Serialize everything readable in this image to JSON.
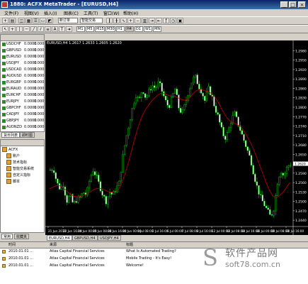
{
  "window": {
    "title": "1880: ACFX MetaTrader - [EURUSD,H4]",
    "controls": [
      "_",
      "□",
      "×"
    ]
  },
  "menu": [
    "文件(F)",
    "视图(V)",
    "插入(I)",
    "图表(C)",
    "工具(T)",
    "窗口(W)",
    "帮助(H)"
  ],
  "toolbar": {
    "new_order_label": "新订单",
    "expert_label": "智能交易",
    "period_labels": [
      "M1",
      "M5",
      "M15",
      "M30",
      "H1",
      "H4",
      "D1",
      "W1",
      "MN"
    ]
  },
  "market_watch": {
    "rows": [
      {
        "symbol": "USDCHF",
        "bid": "0.0000",
        "ask": "0.0000"
      },
      {
        "symbol": "GBPUSD",
        "bid": "0.0000",
        "ask": "0.0000"
      },
      {
        "symbol": "EURUSD",
        "bid": "0.0000",
        "ask": "0.0000"
      },
      {
        "symbol": "USDJPY",
        "bid": "0.0000",
        "ask": "0.0000"
      },
      {
        "symbol": "USDCAD",
        "bid": "0.0000",
        "ask": "0.0000"
      },
      {
        "symbol": "AUDUSD",
        "bid": "0.0000",
        "ask": "0.0000"
      },
      {
        "symbol": "EURGBP",
        "bid": "0.0000",
        "ask": "0.0000"
      },
      {
        "symbol": "EURAUD",
        "bid": "0.0000",
        "ask": "0.0000"
      },
      {
        "symbol": "EURCHF",
        "bid": "0.0000",
        "ask": "0.0000"
      },
      {
        "symbol": "EURJPY",
        "bid": "0.0000",
        "ask": "0.0000"
      },
      {
        "symbol": "GBPCHF",
        "bid": "0.0000",
        "ask": "0.0000"
      },
      {
        "symbol": "CADJPY",
        "bid": "0.0000",
        "ask": "0.0000"
      },
      {
        "symbol": "GBPJPY",
        "bid": "0.0000",
        "ask": "0.0000"
      },
      {
        "symbol": "AUDNZD",
        "bid": "0.0000",
        "ask": "0.0000"
      }
    ],
    "tabs": [
      "货币列表",
      "即时图"
    ]
  },
  "navigator": {
    "title": "ACFX",
    "items": [
      "账户",
      "技术指标",
      "智能交易系统",
      "自定义指标",
      "脚本"
    ],
    "tabs": [
      "常用",
      "收藏夹"
    ]
  },
  "chart": {
    "title": "EURUSD,H4  1.2617 1.2633 1.2605 1.2620",
    "chart_data": {
      "type": "candlestick",
      "symbol": "EURUSD",
      "timeframe": "H4",
      "ylim": [
        1.242,
        1.299
      ],
      "y_ticks": [
        "1.2980",
        "1.2950",
        "1.2920",
        "1.2890",
        "1.2860",
        "1.2830",
        "1.2800",
        "1.2770",
        "1.2740",
        "1.2710",
        "1.2680",
        "1.2650",
        "1.2620",
        "1.2590",
        "1.2560",
        "1.2530",
        "1.2500",
        "1.2470",
        "1.2440"
      ],
      "current_price": "1.2620",
      "x_ticks": [
        "21 Jun 2010",
        "22 Jun 16:00",
        "24 Jun 00:00",
        "25 Jun 08:00",
        "28 Jun 16:00",
        "30 Jun 00:00",
        "1 Jul 08:00",
        "2 Jul 16:00",
        "6 Jul 00:00",
        "7 Jul 08:00",
        "8 Jul 16:00",
        "12 Jul 00:00",
        "13 Jul 08:00",
        "14 Jul 16:00",
        "16 Jul 00:00",
        "19 Jul 08:00",
        "20 Jul 16:00"
      ],
      "candle_color": "#00c000",
      "ma_color": "#c00000",
      "close_path": [
        1.26,
        1.2605,
        1.256,
        1.254,
        1.2555,
        1.25,
        1.252,
        1.249,
        1.2505,
        1.251,
        1.253,
        1.252,
        1.257,
        1.26,
        1.258,
        1.255,
        1.252,
        1.25,
        1.253,
        1.252,
        1.254,
        1.256,
        1.264,
        1.27,
        1.275,
        1.28,
        1.284,
        1.282,
        1.286,
        1.283,
        1.285,
        1.287,
        1.286,
        1.288,
        1.285,
        1.282,
        1.28,
        1.283,
        1.286,
        1.28,
        1.278,
        1.281,
        1.285,
        1.288,
        1.29,
        1.287,
        1.285,
        1.282,
        1.286,
        1.284,
        1.28,
        1.277,
        1.273,
        1.27,
        1.272,
        1.276,
        1.278,
        1.275,
        1.272,
        1.269,
        1.266,
        1.263,
        1.258,
        1.254,
        1.251,
        1.249,
        1.247,
        1.245,
        1.248,
        1.256,
        1.26,
        1.258,
        1.261,
        1.262
      ],
      "ma_path": [
        1.254,
        1.2545,
        1.255,
        1.255,
        1.2545,
        1.2535,
        1.2525,
        1.2518,
        1.2515,
        1.2515,
        1.2518,
        1.2522,
        1.2528,
        1.2535,
        1.254,
        1.2542,
        1.254,
        1.2535,
        1.253,
        1.253,
        1.2532,
        1.2538,
        1.256,
        1.259,
        1.2625,
        1.2665,
        1.2705,
        1.274,
        1.277,
        1.279,
        1.2805,
        1.282,
        1.283,
        1.284,
        1.2845,
        1.2843,
        1.2838,
        1.2835,
        1.2835,
        1.283,
        1.2825,
        1.2822,
        1.2825,
        1.2835,
        1.2848,
        1.2855,
        1.2857,
        1.2853,
        1.285,
        1.2845,
        1.2835,
        1.282,
        1.28,
        1.278,
        1.2765,
        1.2755,
        1.275,
        1.2745,
        1.2738,
        1.2725,
        1.2708,
        1.2688,
        1.2665,
        1.2638,
        1.261,
        1.2582,
        1.2555,
        1.253,
        1.2515,
        1.2512,
        1.252,
        1.253,
        1.2545,
        1.256
      ]
    },
    "tabs": [
      "EURUSD,H4",
      "GBPUSD,H4",
      "USDJPY,H4"
    ]
  },
  "terminal": {
    "headers": [
      "时间",
      "来源",
      "标题"
    ],
    "rows": [
      {
        "time": "2010.01.01 ...",
        "source": "Atlas Capital Financial Services",
        "headline": "What Is Automated Trading?"
      },
      {
        "time": "2010.01.01 ...",
        "source": "Atlas Capital Financial Services",
        "headline": "Mobile Trading - It's Easy!"
      },
      {
        "time": "2010.01.01 ...",
        "source": "Atlas Capital Financial Services",
        "headline": "Welcome!"
      }
    ]
  },
  "watermark": {
    "logo": "S",
    "line1": "软件产品网",
    "line2": "soft78.com.cn"
  }
}
